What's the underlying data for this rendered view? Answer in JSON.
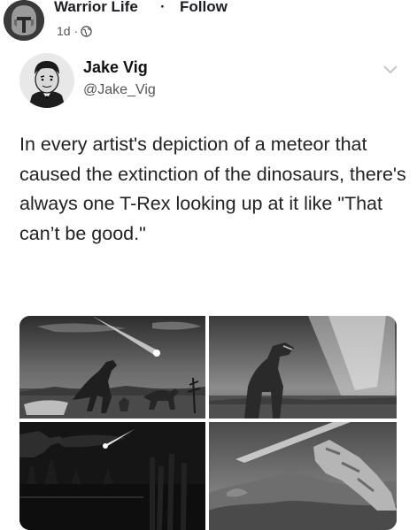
{
  "fb_post": {
    "page_name": "Warrior Life",
    "separator": "·",
    "follow_label": "Follow",
    "time_ago": "1d ·",
    "privacy_icon": "globe-icon"
  },
  "tweet": {
    "author_name": "Jake Vig",
    "author_handle": "@Jake_Vig",
    "menu_icon": "chevron-down-icon",
    "text": "In every artist's depiction of a meteor that caused the extinction of the dinosaurs, there's always one T-Rex looking up at it like \"That can’t be good.\""
  },
  "media": {
    "images": [
      "t-rex-meteor-image-1",
      "t-rex-meteor-image-2",
      "t-rex-meteor-image-3",
      "t-rex-meteor-image-4"
    ]
  }
}
